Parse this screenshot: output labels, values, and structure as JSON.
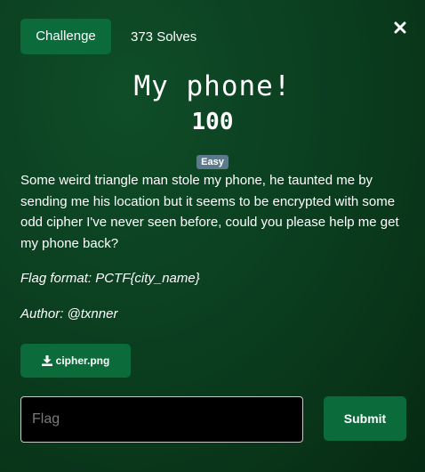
{
  "tabs": {
    "challenge_label": "Challenge",
    "solves_label": "373 Solves"
  },
  "challenge": {
    "title": "My phone!",
    "points": "100",
    "difficulty": "Easy",
    "description": "Some weird triangle man stole my phone, he taunted me by sending me his location but it seems to be encrypted with some odd cipher I've never seen before, could you please help me get my phone back?",
    "flag_format": "Flag format: PCTF{city_name}",
    "author": "Author: @txnner"
  },
  "file": {
    "name": "cipher.png",
    "icon": "download-icon"
  },
  "submission": {
    "placeholder": "Flag",
    "value": "",
    "submit_label": "Submit"
  },
  "icons": {
    "close": "close-icon"
  },
  "colors": {
    "background": "#0b3f20",
    "accent_button": "#0b6b3a",
    "badge": "#5d7a8c",
    "input_background": "#000000"
  }
}
